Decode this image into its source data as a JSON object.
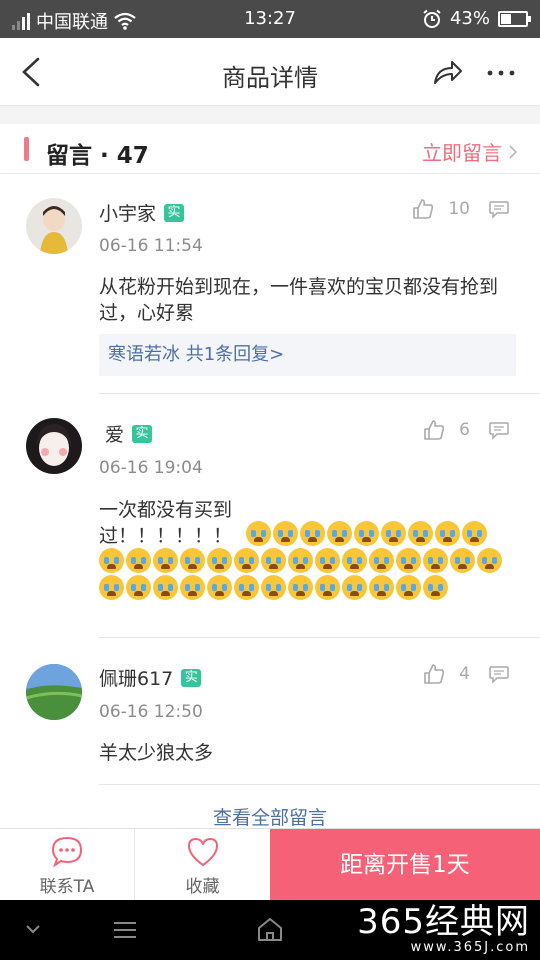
{
  "status_bar": {
    "carrier": "中国联通",
    "time": "13:27",
    "battery": "43%",
    "battery_level": 0.43
  },
  "nav": {
    "title": "商品详情"
  },
  "section": {
    "title": "留言 · 47",
    "action": "立即留言"
  },
  "comments": [
    {
      "name": "小宇家",
      "badge": "实",
      "time": "06-16 11:54",
      "likes": "10",
      "text": "从花粉开始到现在，一件喜欢的宝贝都没有抢到过，心好累",
      "reply": "寒语若冰 共1条回复>"
    },
    {
      "name": "爱",
      "badge": "实",
      "time": "06-16 19:04",
      "likes": "6",
      "text": "一次都没有买到过！！！！！！",
      "emoji_count": 37
    },
    {
      "name": "佩珊617",
      "badge": "实",
      "time": "06-16 12:50",
      "likes": "4",
      "text": "羊太少狼太多"
    }
  ],
  "view_all": "查看全部留言",
  "bottom_bar": {
    "contact_label": "联系TA",
    "favorite_label": "收藏",
    "sale_button": "距离开售1天"
  },
  "watermark": {
    "big": "365经典网",
    "small": "www.365J.com"
  },
  "colors": {
    "accent": "#f56277",
    "link": "#4f6fa6",
    "badge": "#35c59c"
  }
}
